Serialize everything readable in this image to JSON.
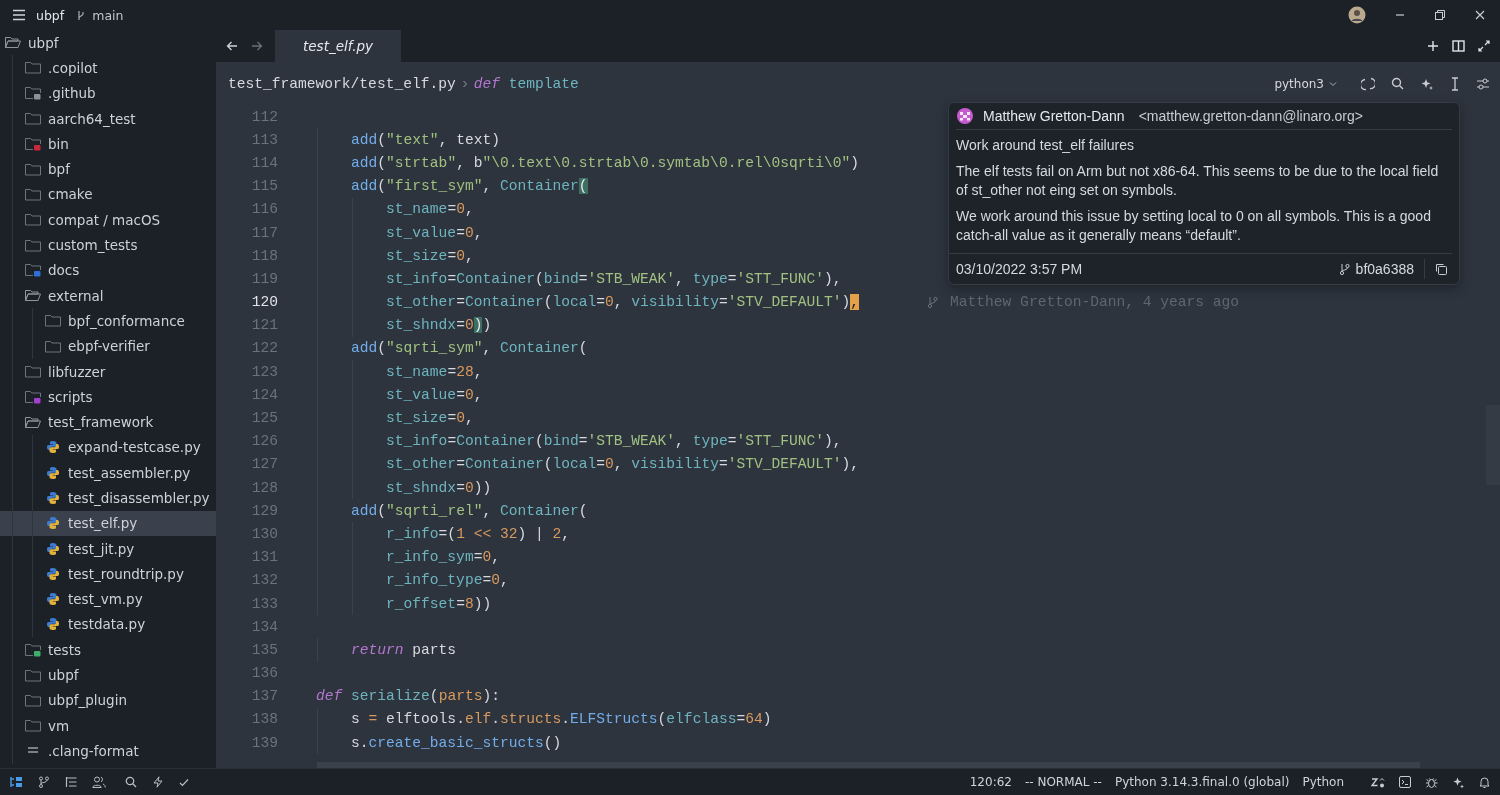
{
  "title_bar": {
    "project": "ubpf",
    "branch": "main"
  },
  "sidebar": {
    "items": [
      {
        "label": "ubpf",
        "kind": "folder",
        "expanded": true,
        "selected": false,
        "children": [
          {
            "label": ".copilot",
            "kind": "folder",
            "expanded": false,
            "selected": false
          },
          {
            "label": ".github",
            "kind": "folder-badge",
            "color": "#8b929c",
            "expanded": false,
            "selected": false
          },
          {
            "label": "aarch64_test",
            "kind": "folder",
            "expanded": false,
            "selected": false
          },
          {
            "label": "bin",
            "kind": "folder-badge",
            "color": "#c8283c",
            "expanded": false,
            "selected": false
          },
          {
            "label": "bpf",
            "kind": "folder",
            "expanded": false,
            "selected": false
          },
          {
            "label": "cmake",
            "kind": "folder",
            "expanded": false,
            "selected": false
          },
          {
            "label": "compat / macOS",
            "kind": "folder",
            "expanded": false,
            "selected": false
          },
          {
            "label": "custom_tests",
            "kind": "folder",
            "expanded": false,
            "selected": false
          },
          {
            "label": "docs",
            "kind": "folder-badge",
            "color": "#2f6fd6",
            "expanded": false,
            "selected": false
          },
          {
            "label": "external",
            "kind": "folder",
            "expanded": true,
            "selected": false,
            "children": [
              {
                "label": "bpf_conformance",
                "kind": "folder",
                "expanded": false,
                "selected": false
              },
              {
                "label": "ebpf-verifier",
                "kind": "folder",
                "expanded": false,
                "selected": false
              }
            ]
          },
          {
            "label": "libfuzzer",
            "kind": "folder",
            "expanded": false,
            "selected": false
          },
          {
            "label": "scripts",
            "kind": "folder-badge",
            "color": "#a23fd0",
            "expanded": false,
            "selected": false
          },
          {
            "label": "test_framework",
            "kind": "folder",
            "expanded": true,
            "selected": false,
            "children": [
              {
                "label": "expand-testcase.py",
                "kind": "python",
                "selected": false
              },
              {
                "label": "test_assembler.py",
                "kind": "python",
                "selected": false
              },
              {
                "label": "test_disassembler.py",
                "kind": "python",
                "selected": false
              },
              {
                "label": "test_elf.py",
                "kind": "python",
                "selected": true
              },
              {
                "label": "test_jit.py",
                "kind": "python",
                "selected": false
              },
              {
                "label": "test_roundtrip.py",
                "kind": "python",
                "selected": false
              },
              {
                "label": "test_vm.py",
                "kind": "python",
                "selected": false
              },
              {
                "label": "testdata.py",
                "kind": "python",
                "selected": false
              }
            ]
          },
          {
            "label": "tests",
            "kind": "folder-badge",
            "color": "#3fae6a",
            "expanded": false,
            "selected": false
          },
          {
            "label": "ubpf",
            "kind": "folder",
            "expanded": false,
            "selected": false
          },
          {
            "label": "ubpf_plugin",
            "kind": "folder",
            "expanded": false,
            "selected": false
          },
          {
            "label": "vm",
            "kind": "folder",
            "expanded": false,
            "selected": false
          },
          {
            "label": ".clang-format",
            "kind": "text",
            "selected": false
          }
        ]
      }
    ]
  },
  "tabs": [
    {
      "label": "test_elf.py",
      "selected": true
    }
  ],
  "breadcrumb": {
    "path": "test_framework/test_elf.py",
    "keyword": "def",
    "symbol": "template"
  },
  "kernel": "python3",
  "code": {
    "lines": [
      {
        "number": "112",
        "current": false
      },
      {
        "number": "113",
        "current": false,
        "tokens": [
          {
            "text": "    add",
            "kind": "fn"
          },
          {
            "text": "(",
            "kind": "p"
          },
          {
            "text": "\"text\"",
            "kind": "str"
          },
          {
            "text": ", text)",
            "kind": "p"
          }
        ]
      },
      {
        "number": "114",
        "current": false,
        "tokens": [
          {
            "text": "    add",
            "kind": "fn"
          },
          {
            "text": "(",
            "kind": "p"
          },
          {
            "text": "\"strtab\"",
            "kind": "str"
          },
          {
            "text": ", b",
            "kind": "p"
          },
          {
            "text": "\"\\0.text\\0.strtab\\0.symtab\\0.rel\\0sqrti\\0\"",
            "kind": "str"
          },
          {
            "text": ")",
            "kind": "p"
          }
        ]
      },
      {
        "number": "115",
        "current": false,
        "tokens": [
          {
            "text": "    add",
            "kind": "fn"
          },
          {
            "text": "(",
            "kind": "p"
          },
          {
            "text": "\"first_sym\"",
            "kind": "str"
          },
          {
            "text": ", ",
            "kind": "p"
          },
          {
            "text": "Container",
            "kind": "cls"
          },
          {
            "text": "(",
            "kind": "match"
          }
        ]
      },
      {
        "number": "116",
        "current": false,
        "tokens": [
          {
            "text": "        st_name",
            "kind": "attr"
          },
          {
            "text": "=",
            "kind": "p"
          },
          {
            "text": "0",
            "kind": "num"
          },
          {
            "text": ",",
            "kind": "p"
          }
        ]
      },
      {
        "number": "117",
        "current": false,
        "tokens": [
          {
            "text": "        st_value",
            "kind": "attr"
          },
          {
            "text": "=",
            "kind": "p"
          },
          {
            "text": "0",
            "kind": "num"
          },
          {
            "text": ",",
            "kind": "p"
          }
        ]
      },
      {
        "number": "118",
        "current": false,
        "tokens": [
          {
            "text": "        st_size",
            "kind": "attr"
          },
          {
            "text": "=",
            "kind": "p"
          },
          {
            "text": "0",
            "kind": "num"
          },
          {
            "text": ",",
            "kind": "p"
          }
        ]
      },
      {
        "number": "119",
        "current": false,
        "tokens": [
          {
            "text": "        st_info",
            "kind": "attr"
          },
          {
            "text": "=",
            "kind": "p"
          },
          {
            "text": "Container",
            "kind": "cls"
          },
          {
            "text": "(",
            "kind": "p"
          },
          {
            "text": "bind",
            "kind": "attr"
          },
          {
            "text": "=",
            "kind": "p"
          },
          {
            "text": "'STB_WEAK'",
            "kind": "str"
          },
          {
            "text": ", ",
            "kind": "p"
          },
          {
            "text": "type",
            "kind": "attr"
          },
          {
            "text": "=",
            "kind": "p"
          },
          {
            "text": "'STT_FUNC'",
            "kind": "str"
          },
          {
            "text": "),",
            "kind": "p"
          }
        ]
      },
      {
        "number": "120",
        "current": true,
        "tokens": [
          {
            "text": "        st_other",
            "kind": "attr"
          },
          {
            "text": "=",
            "kind": "p"
          },
          {
            "text": "Container",
            "kind": "cls"
          },
          {
            "text": "(",
            "kind": "p"
          },
          {
            "text": "local",
            "kind": "attr"
          },
          {
            "text": "=",
            "kind": "p"
          },
          {
            "text": "0",
            "kind": "num"
          },
          {
            "text": ", ",
            "kind": "p"
          },
          {
            "text": "visibility",
            "kind": "attr"
          },
          {
            "text": "=",
            "kind": "p"
          },
          {
            "text": "'STV_DEFAULT'",
            "kind": "str"
          },
          {
            "text": ")",
            "kind": "p"
          },
          {
            "text": ",",
            "kind": "cursor"
          }
        ],
        "blame": "Matthew Gretton-Dann, 4 years ago"
      },
      {
        "number": "121",
        "current": false,
        "tokens": [
          {
            "text": "        st_shndx",
            "kind": "attr"
          },
          {
            "text": "=",
            "kind": "p"
          },
          {
            "text": "0",
            "kind": "num"
          },
          {
            "text": ")",
            "kind": "match"
          },
          {
            "text": ")",
            "kind": "p"
          }
        ]
      },
      {
        "number": "122",
        "current": false,
        "tokens": [
          {
            "text": "    add",
            "kind": "fn"
          },
          {
            "text": "(",
            "kind": "p"
          },
          {
            "text": "\"sqrti_sym\"",
            "kind": "str"
          },
          {
            "text": ", ",
            "kind": "p"
          },
          {
            "text": "Container",
            "kind": "cls"
          },
          {
            "text": "(",
            "kind": "p"
          }
        ]
      },
      {
        "number": "123",
        "current": false,
        "tokens": [
          {
            "text": "        st_name",
            "kind": "attr"
          },
          {
            "text": "=",
            "kind": "p"
          },
          {
            "text": "28",
            "kind": "num"
          },
          {
            "text": ",",
            "kind": "p"
          }
        ]
      },
      {
        "number": "124",
        "current": false,
        "tokens": [
          {
            "text": "        st_value",
            "kind": "attr"
          },
          {
            "text": "=",
            "kind": "p"
          },
          {
            "text": "0",
            "kind": "num"
          },
          {
            "text": ",",
            "kind": "p"
          }
        ]
      },
      {
        "number": "125",
        "current": false,
        "tokens": [
          {
            "text": "        st_size",
            "kind": "attr"
          },
          {
            "text": "=",
            "kind": "p"
          },
          {
            "text": "0",
            "kind": "num"
          },
          {
            "text": ",",
            "kind": "p"
          }
        ]
      },
      {
        "number": "126",
        "current": false,
        "tokens": [
          {
            "text": "        st_info",
            "kind": "attr"
          },
          {
            "text": "=",
            "kind": "p"
          },
          {
            "text": "Container",
            "kind": "cls"
          },
          {
            "text": "(",
            "kind": "p"
          },
          {
            "text": "bind",
            "kind": "attr"
          },
          {
            "text": "=",
            "kind": "p"
          },
          {
            "text": "'STB_WEAK'",
            "kind": "str"
          },
          {
            "text": ", ",
            "kind": "p"
          },
          {
            "text": "type",
            "kind": "attr"
          },
          {
            "text": "=",
            "kind": "p"
          },
          {
            "text": "'STT_FUNC'",
            "kind": "str"
          },
          {
            "text": "),",
            "kind": "p"
          }
        ]
      },
      {
        "number": "127",
        "current": false,
        "tokens": [
          {
            "text": "        st_other",
            "kind": "attr"
          },
          {
            "text": "=",
            "kind": "p"
          },
          {
            "text": "Container",
            "kind": "cls"
          },
          {
            "text": "(",
            "kind": "p"
          },
          {
            "text": "local",
            "kind": "attr"
          },
          {
            "text": "=",
            "kind": "p"
          },
          {
            "text": "0",
            "kind": "num"
          },
          {
            "text": ", ",
            "kind": "p"
          },
          {
            "text": "visibility",
            "kind": "attr"
          },
          {
            "text": "=",
            "kind": "p"
          },
          {
            "text": "'STV_DEFAULT'",
            "kind": "str"
          },
          {
            "text": "),",
            "kind": "p"
          }
        ]
      },
      {
        "number": "128",
        "current": false,
        "tokens": [
          {
            "text": "        st_shndx",
            "kind": "attr"
          },
          {
            "text": "=",
            "kind": "p"
          },
          {
            "text": "0",
            "kind": "num"
          },
          {
            "text": "))",
            "kind": "p"
          }
        ]
      },
      {
        "number": "129",
        "current": false,
        "tokens": [
          {
            "text": "    add",
            "kind": "fn"
          },
          {
            "text": "(",
            "kind": "p"
          },
          {
            "text": "\"sqrti_rel\"",
            "kind": "str"
          },
          {
            "text": ", ",
            "kind": "p"
          },
          {
            "text": "Container",
            "kind": "cls"
          },
          {
            "text": "(",
            "kind": "p"
          }
        ]
      },
      {
        "number": "130",
        "current": false,
        "tokens": [
          {
            "text": "        r_info",
            "kind": "attr"
          },
          {
            "text": "=(",
            "kind": "p"
          },
          {
            "text": "1 << 32",
            "kind": "num"
          },
          {
            "text": ") | ",
            "kind": "p"
          },
          {
            "text": "2",
            "kind": "num"
          },
          {
            "text": ",",
            "kind": "p"
          }
        ]
      },
      {
        "number": "131",
        "current": false,
        "tokens": [
          {
            "text": "        r_info_sym",
            "kind": "attr"
          },
          {
            "text": "=",
            "kind": "p"
          },
          {
            "text": "0",
            "kind": "num"
          },
          {
            "text": ",",
            "kind": "p"
          }
        ]
      },
      {
        "number": "132",
        "current": false,
        "tokens": [
          {
            "text": "        r_info_type",
            "kind": "attr"
          },
          {
            "text": "=",
            "kind": "p"
          },
          {
            "text": "0",
            "kind": "num"
          },
          {
            "text": ",",
            "kind": "p"
          }
        ]
      },
      {
        "number": "133",
        "current": false,
        "tokens": [
          {
            "text": "        r_offset",
            "kind": "attr"
          },
          {
            "text": "=",
            "kind": "p"
          },
          {
            "text": "8",
            "kind": "num"
          },
          {
            "text": "))",
            "kind": "p"
          }
        ]
      },
      {
        "number": "134",
        "current": false
      },
      {
        "number": "135",
        "current": false,
        "tokens": [
          {
            "text": "    return",
            "kind": "kw"
          },
          {
            "text": " parts",
            "kind": "p"
          }
        ]
      },
      {
        "number": "136",
        "current": false
      },
      {
        "number": "137",
        "current": false,
        "tokens": [
          {
            "text": "def",
            "kind": "kw"
          },
          {
            "text": " serialize",
            "kind": "cls"
          },
          {
            "text": "(",
            "kind": "p"
          },
          {
            "text": "parts",
            "kind": "num"
          },
          {
            "text": "):",
            "kind": "p"
          }
        ]
      },
      {
        "number": "138",
        "current": false,
        "tokens": [
          {
            "text": "    s ",
            "kind": "p"
          },
          {
            "text": "=",
            "kind": "num"
          },
          {
            "text": " elftools.",
            "kind": "p"
          },
          {
            "text": "elf",
            "kind": "num"
          },
          {
            "text": ".",
            "kind": "p"
          },
          {
            "text": "structs",
            "kind": "num"
          },
          {
            "text": ".",
            "kind": "p"
          },
          {
            "text": "ELFStructs",
            "kind": "fn"
          },
          {
            "text": "(",
            "kind": "p"
          },
          {
            "text": "elfclass",
            "kind": "attr"
          },
          {
            "text": "=",
            "kind": "p"
          },
          {
            "text": "64",
            "kind": "num"
          },
          {
            "text": ")",
            "kind": "p"
          }
        ]
      },
      {
        "number": "139",
        "current": false,
        "tokens": [
          {
            "text": "    s.",
            "kind": "p"
          },
          {
            "text": "create_basic_structs",
            "kind": "fn"
          },
          {
            "text": "()",
            "kind": "p"
          }
        ]
      }
    ]
  },
  "blame_popup": {
    "author": "Matthew Gretton-Dann",
    "email": "<matthew.gretton-dann@linaro.org>",
    "subject": "Work around test_elf failures",
    "body": [
      "The elf tests fail on Arm but not x86-64.  This seems to be due to the local field of st_other not eing set on symbols.",
      "We work around this issue by setting local to 0 on all symbols.  This is a good catch-all value as it generally means “default”."
    ],
    "date": "03/10/2022 3:57 PM",
    "sha": "bf0a6388"
  },
  "status_bar": {
    "position": "120:62",
    "mode": "-- NORMAL --",
    "interpreter": "Python 3.14.3.final.0 (global)",
    "language": "Python"
  }
}
